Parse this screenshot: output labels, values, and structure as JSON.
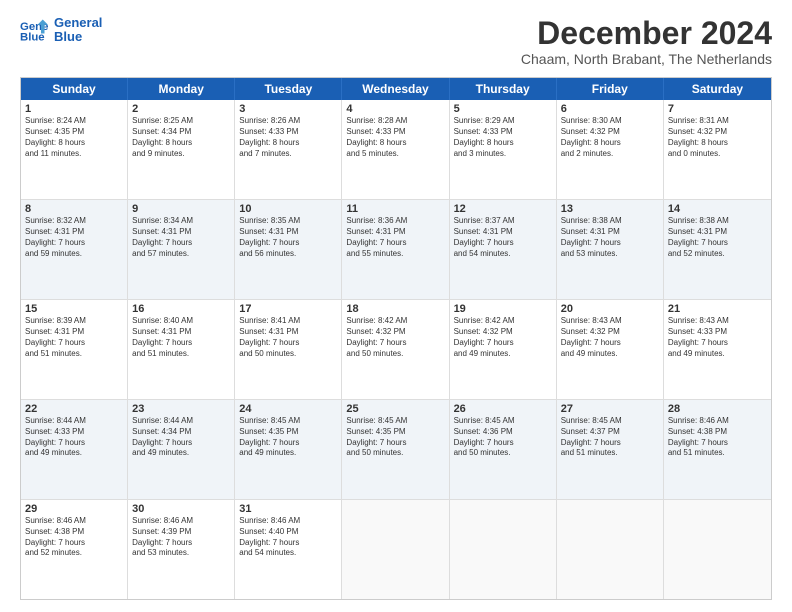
{
  "logo": {
    "line1": "General",
    "line2": "Blue"
  },
  "title": "December 2024",
  "subtitle": "Chaam, North Brabant, The Netherlands",
  "days": [
    "Sunday",
    "Monday",
    "Tuesday",
    "Wednesday",
    "Thursday",
    "Friday",
    "Saturday"
  ],
  "rows": [
    [
      {
        "num": "1",
        "text": "Sunrise: 8:24 AM\nSunset: 4:35 PM\nDaylight: 8 hours\nand 11 minutes."
      },
      {
        "num": "2",
        "text": "Sunrise: 8:25 AM\nSunset: 4:34 PM\nDaylight: 8 hours\nand 9 minutes."
      },
      {
        "num": "3",
        "text": "Sunrise: 8:26 AM\nSunset: 4:33 PM\nDaylight: 8 hours\nand 7 minutes."
      },
      {
        "num": "4",
        "text": "Sunrise: 8:28 AM\nSunset: 4:33 PM\nDaylight: 8 hours\nand 5 minutes."
      },
      {
        "num": "5",
        "text": "Sunrise: 8:29 AM\nSunset: 4:33 PM\nDaylight: 8 hours\nand 3 minutes."
      },
      {
        "num": "6",
        "text": "Sunrise: 8:30 AM\nSunset: 4:32 PM\nDaylight: 8 hours\nand 2 minutes."
      },
      {
        "num": "7",
        "text": "Sunrise: 8:31 AM\nSunset: 4:32 PM\nDaylight: 8 hours\nand 0 minutes."
      }
    ],
    [
      {
        "num": "8",
        "text": "Sunrise: 8:32 AM\nSunset: 4:31 PM\nDaylight: 7 hours\nand 59 minutes."
      },
      {
        "num": "9",
        "text": "Sunrise: 8:34 AM\nSunset: 4:31 PM\nDaylight: 7 hours\nand 57 minutes."
      },
      {
        "num": "10",
        "text": "Sunrise: 8:35 AM\nSunset: 4:31 PM\nDaylight: 7 hours\nand 56 minutes."
      },
      {
        "num": "11",
        "text": "Sunrise: 8:36 AM\nSunset: 4:31 PM\nDaylight: 7 hours\nand 55 minutes."
      },
      {
        "num": "12",
        "text": "Sunrise: 8:37 AM\nSunset: 4:31 PM\nDaylight: 7 hours\nand 54 minutes."
      },
      {
        "num": "13",
        "text": "Sunrise: 8:38 AM\nSunset: 4:31 PM\nDaylight: 7 hours\nand 53 minutes."
      },
      {
        "num": "14",
        "text": "Sunrise: 8:38 AM\nSunset: 4:31 PM\nDaylight: 7 hours\nand 52 minutes."
      }
    ],
    [
      {
        "num": "15",
        "text": "Sunrise: 8:39 AM\nSunset: 4:31 PM\nDaylight: 7 hours\nand 51 minutes."
      },
      {
        "num": "16",
        "text": "Sunrise: 8:40 AM\nSunset: 4:31 PM\nDaylight: 7 hours\nand 51 minutes."
      },
      {
        "num": "17",
        "text": "Sunrise: 8:41 AM\nSunset: 4:31 PM\nDaylight: 7 hours\nand 50 minutes."
      },
      {
        "num": "18",
        "text": "Sunrise: 8:42 AM\nSunset: 4:32 PM\nDaylight: 7 hours\nand 50 minutes."
      },
      {
        "num": "19",
        "text": "Sunrise: 8:42 AM\nSunset: 4:32 PM\nDaylight: 7 hours\nand 49 minutes."
      },
      {
        "num": "20",
        "text": "Sunrise: 8:43 AM\nSunset: 4:32 PM\nDaylight: 7 hours\nand 49 minutes."
      },
      {
        "num": "21",
        "text": "Sunrise: 8:43 AM\nSunset: 4:33 PM\nDaylight: 7 hours\nand 49 minutes."
      }
    ],
    [
      {
        "num": "22",
        "text": "Sunrise: 8:44 AM\nSunset: 4:33 PM\nDaylight: 7 hours\nand 49 minutes."
      },
      {
        "num": "23",
        "text": "Sunrise: 8:44 AM\nSunset: 4:34 PM\nDaylight: 7 hours\nand 49 minutes."
      },
      {
        "num": "24",
        "text": "Sunrise: 8:45 AM\nSunset: 4:35 PM\nDaylight: 7 hours\nand 49 minutes."
      },
      {
        "num": "25",
        "text": "Sunrise: 8:45 AM\nSunset: 4:35 PM\nDaylight: 7 hours\nand 50 minutes."
      },
      {
        "num": "26",
        "text": "Sunrise: 8:45 AM\nSunset: 4:36 PM\nDaylight: 7 hours\nand 50 minutes."
      },
      {
        "num": "27",
        "text": "Sunrise: 8:45 AM\nSunset: 4:37 PM\nDaylight: 7 hours\nand 51 minutes."
      },
      {
        "num": "28",
        "text": "Sunrise: 8:46 AM\nSunset: 4:38 PM\nDaylight: 7 hours\nand 51 minutes."
      }
    ],
    [
      {
        "num": "29",
        "text": "Sunrise: 8:46 AM\nSunset: 4:38 PM\nDaylight: 7 hours\nand 52 minutes."
      },
      {
        "num": "30",
        "text": "Sunrise: 8:46 AM\nSunset: 4:39 PM\nDaylight: 7 hours\nand 53 minutes."
      },
      {
        "num": "31",
        "text": "Sunrise: 8:46 AM\nSunset: 4:40 PM\nDaylight: 7 hours\nand 54 minutes."
      },
      {
        "num": "",
        "text": ""
      },
      {
        "num": "",
        "text": ""
      },
      {
        "num": "",
        "text": ""
      },
      {
        "num": "",
        "text": ""
      }
    ]
  ]
}
